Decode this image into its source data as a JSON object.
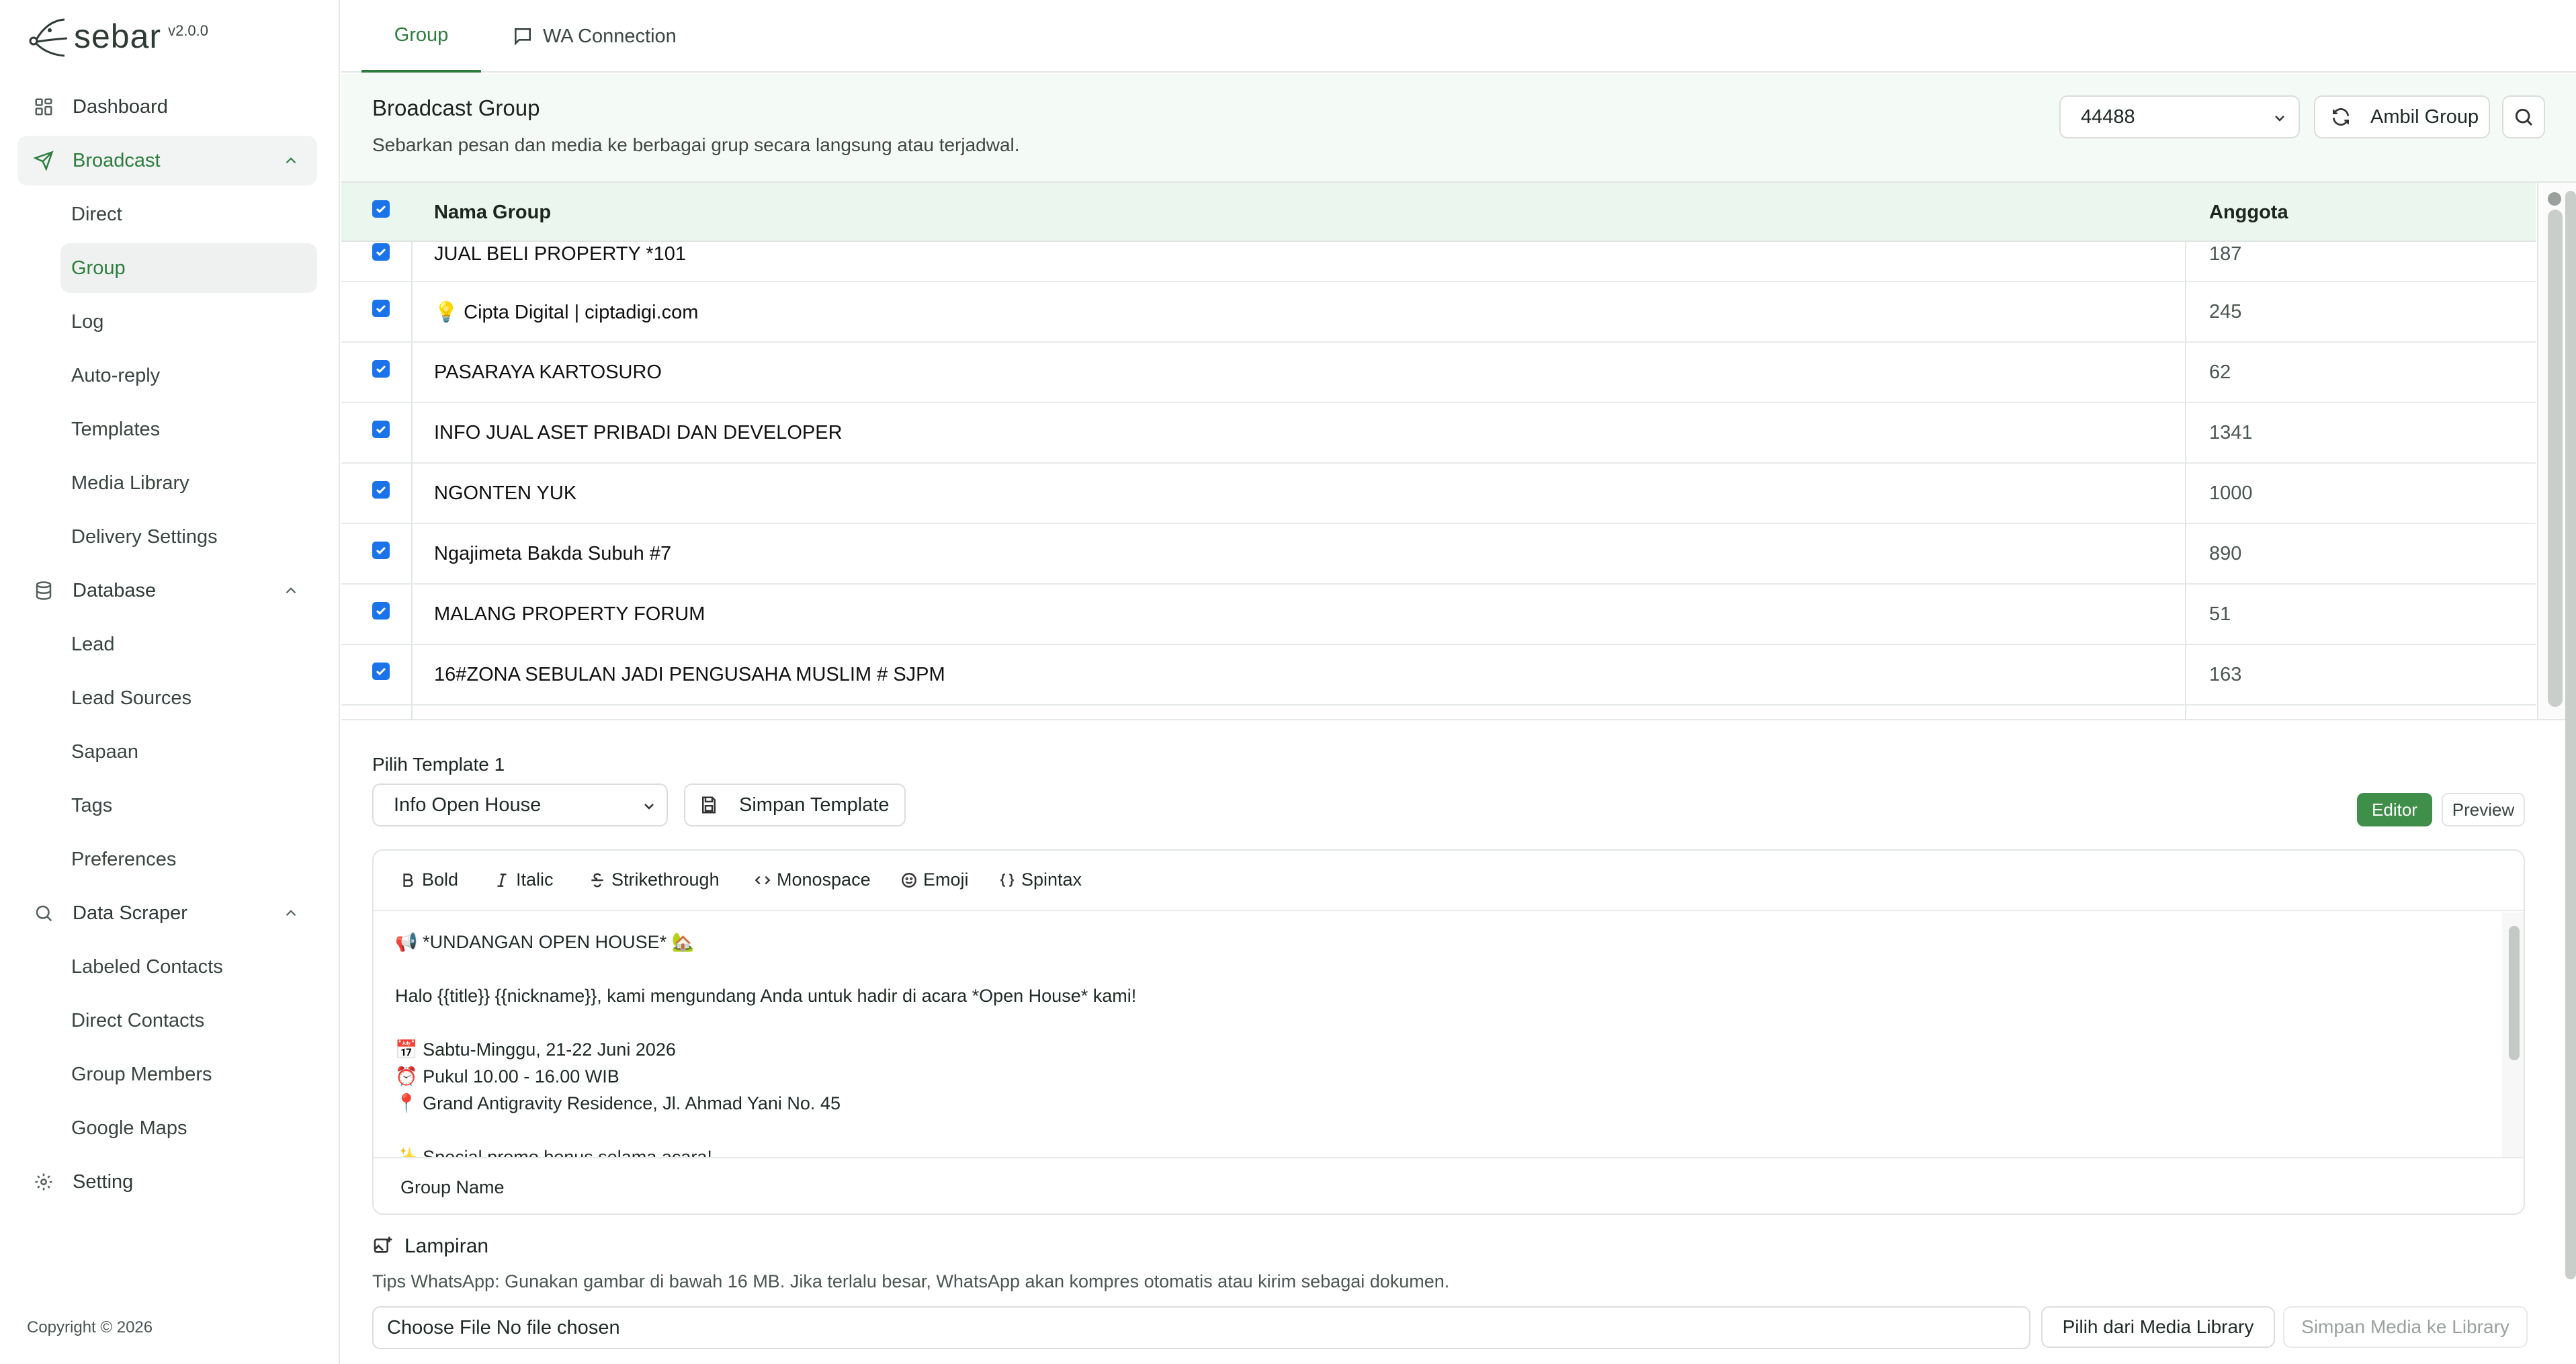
{
  "app": {
    "logo_text": "sebar",
    "version": "v2.0.0"
  },
  "sidebar": {
    "items": [
      {
        "label": "Dashboard",
        "icon": "dashboard-icon"
      },
      {
        "label": "Broadcast",
        "icon": "send-icon",
        "expanded": true,
        "active": true
      },
      {
        "label": "Direct"
      },
      {
        "label": "Group",
        "active": true
      },
      {
        "label": "Log"
      },
      {
        "label": "Auto-reply"
      },
      {
        "label": "Templates"
      },
      {
        "label": "Media Library"
      },
      {
        "label": "Delivery Settings"
      },
      {
        "label": "Database",
        "icon": "database-icon",
        "expanded": true
      },
      {
        "label": "Lead"
      },
      {
        "label": "Lead Sources"
      },
      {
        "label": "Sapaan"
      },
      {
        "label": "Tags"
      },
      {
        "label": "Preferences"
      },
      {
        "label": "Data Scraper",
        "icon": "search-icon",
        "expanded": true
      },
      {
        "label": "Labeled Contacts"
      },
      {
        "label": "Direct Contacts"
      },
      {
        "label": "Group Members"
      },
      {
        "label": "Google Maps"
      },
      {
        "label": "Setting",
        "icon": "gear-icon"
      }
    ],
    "copyright": "Copyright © 2026"
  },
  "tabs": [
    {
      "label": "Group",
      "active": true
    },
    {
      "label": "WA Connection",
      "icon": "chat-icon"
    }
  ],
  "header": {
    "title": "Broadcast Group",
    "subtitle": "Sebarkan pesan dan media ke berbagai grup secara langsung atau terjadwal.",
    "account_select": "44488",
    "ambil_button": "Ambil Group"
  },
  "table": {
    "columns": {
      "name": "Nama Group",
      "count": "Anggota"
    },
    "rows": [
      {
        "name": "JUAL BELI PROPERTY *101",
        "count": "187",
        "checked": true
      },
      {
        "name": "💡 Cipta Digital | ciptadigi.com",
        "count": "245",
        "checked": true
      },
      {
        "name": "PASARAYA KARTOSURO",
        "count": "62",
        "checked": true
      },
      {
        "name": "INFO JUAL ASET PRIBADI DAN DEVELOPER",
        "count": "1341",
        "checked": true
      },
      {
        "name": "NGONTEN YUK",
        "count": "1000",
        "checked": true
      },
      {
        "name": "Ngajimeta Bakda Subuh #7",
        "count": "890",
        "checked": true
      },
      {
        "name": "MALANG PROPERTY FORUM",
        "count": "51",
        "checked": true
      },
      {
        "name": "16#ZONA SEBULAN JADI PENGUSAHA MUSLIM # SJPM",
        "count": "163",
        "checked": true
      }
    ]
  },
  "template": {
    "label": "Pilih Template 1",
    "selected": "Info Open House",
    "save_button": "Simpan Template",
    "editor_tab": "Editor",
    "preview_tab": "Preview",
    "toolbar": {
      "bold": "Bold",
      "italic": "Italic",
      "strike": "Strikethrough",
      "mono": "Monospace",
      "emoji": "Emoji",
      "spintax": "Spintax"
    },
    "message": "📢 *UNDANGAN OPEN HOUSE* 🏡\n\nHalo {{title}} {{nickname}}, kami mengundang Anda untuk hadir di acara *Open House* kami!\n\n📅 Sabtu-Minggu, 21-22 Juni 2026\n⏰ Pukul 10.00 - 16.00 WIB\n📍 Grand Antigravity Residence, Jl. Ahmad Yani No. 45\n\n✨ Special promo bonus selama acara!",
    "variable_label": "Group Name"
  },
  "attachment": {
    "title": "Lampiran",
    "tip": "Tips WhatsApp: Gunakan gambar di bawah 16 MB. Jika terlalu besar, WhatsApp akan kompres otomatis atau kirim sebagai dokumen.",
    "file_input": "Choose File  No file chosen",
    "media_button": "Pilih dari Media Library",
    "save_media_button": "Simpan Media ke Library"
  },
  "colors": {
    "accent": "#2e7d3e",
    "header_band": "#f4faf6",
    "checkbox": "#1a73e8"
  }
}
